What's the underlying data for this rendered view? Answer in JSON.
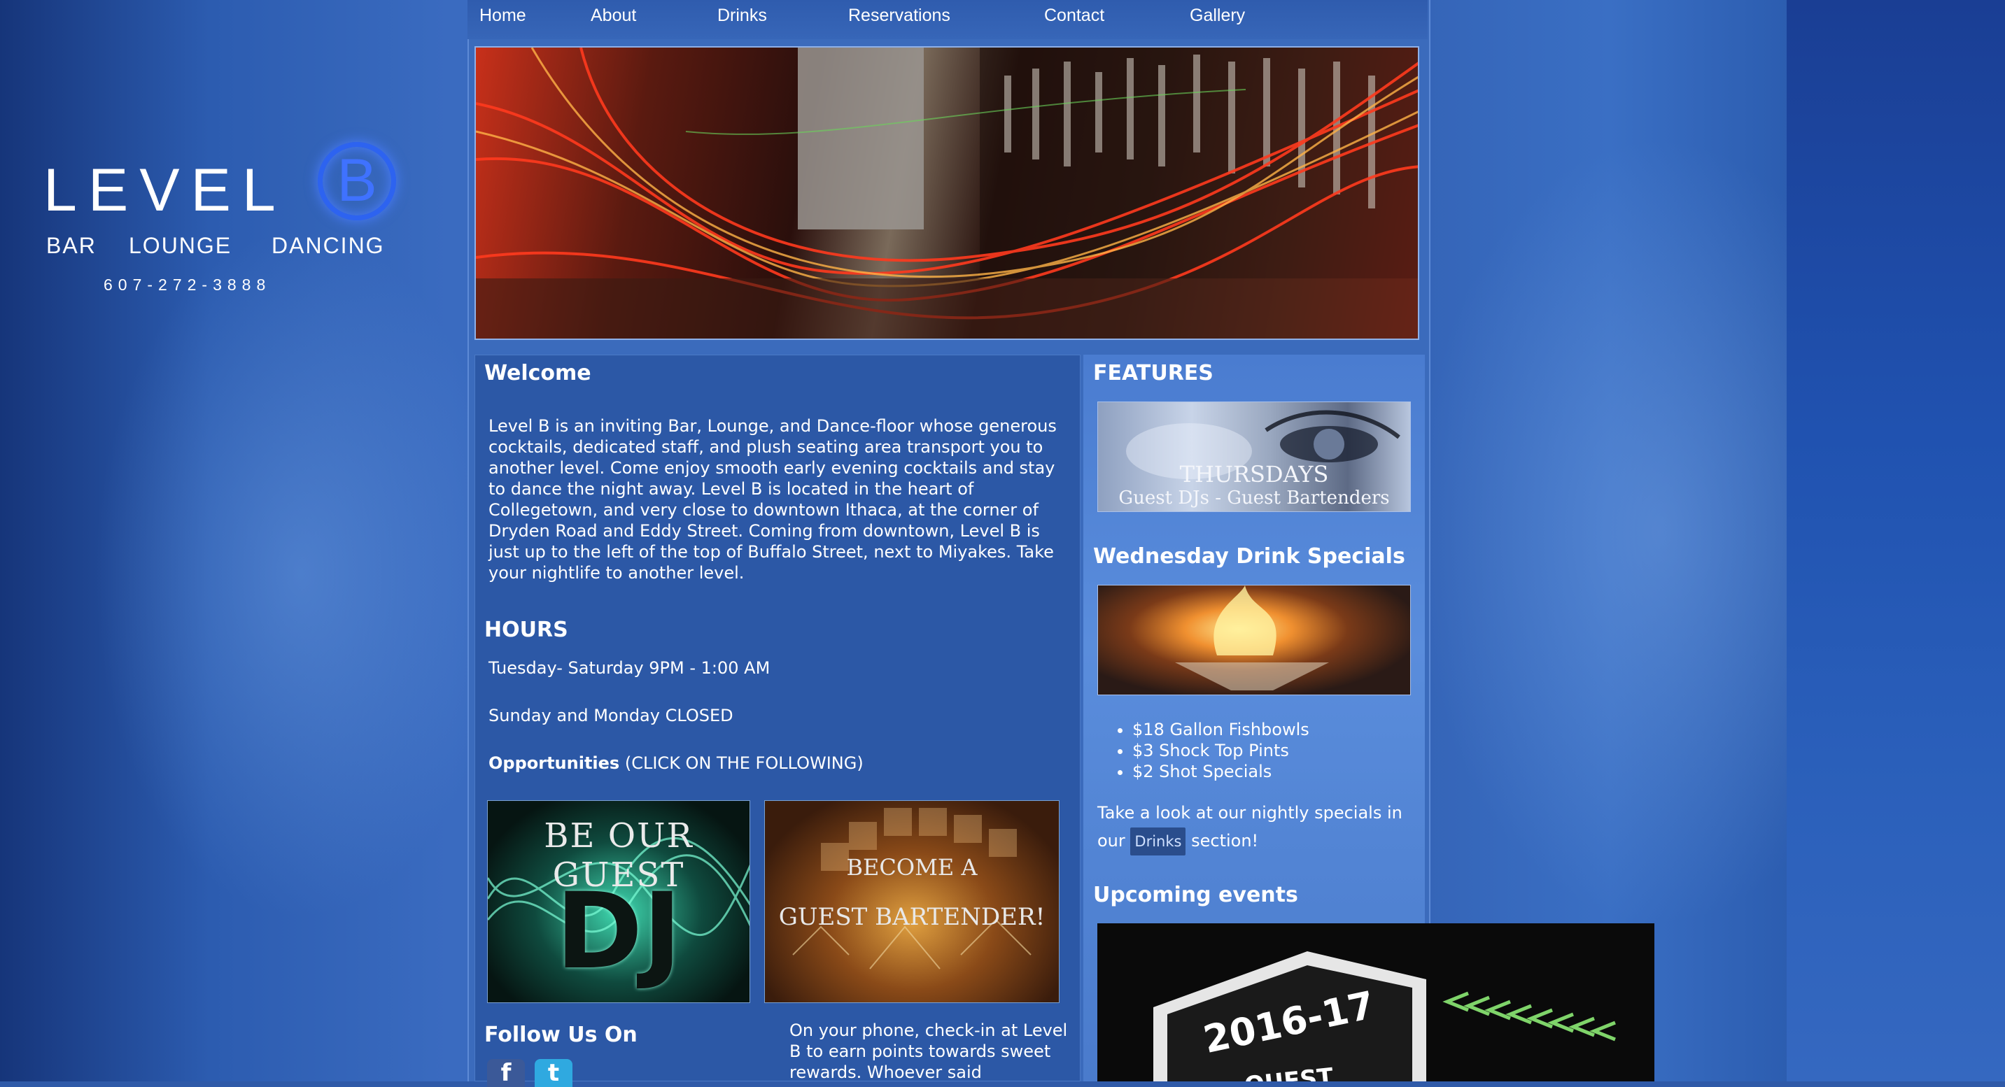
{
  "nav": {
    "items": [
      "Home",
      "About",
      "Drinks",
      "Reservations",
      "Contact",
      "Gallery"
    ]
  },
  "logo": {
    "word": "LEVEL",
    "letter": "B",
    "tag_bar": "BAR",
    "tag_lounge": "LOUNGE",
    "tag_dancing": "DANCING",
    "phone": "607-272-3888"
  },
  "welcome": {
    "heading": "Welcome",
    "body": "Level B is an inviting Bar, Lounge, and Dance-floor whose generous cocktails, dedicated staff, and plush seating area transport you to another level. Come enjoy smooth early evening cocktails and stay to dance the night away. Level B is located in the heart of Collegetown, and very close to downtown Ithaca, at the corner of Dryden Road and Eddy Street. Coming from downtown, Level B is just up to the left of the top of Buffalo Street, next to Miyakes. Take your nightlife to another level."
  },
  "hours": {
    "heading": "HOURS",
    "line1": "Tuesday- Saturday 9PM - 1:00 AM",
    "line2": "Sunday and Monday CLOSED"
  },
  "opportunities": {
    "label": "Opportunities",
    "note": "(CLICK ON THE FOLLOWING)",
    "dj_line1": "BE OUR GUEST",
    "dj_line2": "DJ",
    "bartender_line1": "BECOME A",
    "bartender_line2": "GUEST BARTENDER!"
  },
  "follow": {
    "heading": "Follow Us On",
    "facebook_glyph": "f",
    "twitter_glyph": "t",
    "checkin_text": "On your phone, check-in at Level B to earn points towards sweet rewards. Whoever said"
  },
  "features": {
    "heading": "FEATURES",
    "thursdays_title": "THURSDAYS",
    "thursdays_sub": "Guest DJs - Guest Bartenders"
  },
  "wednesday": {
    "heading": "Wednesday Drink Specials",
    "specials": [
      "$18 Gallon Fishbowls",
      "$3 Shock Top Pints",
      "$2 Shot Specials"
    ],
    "note_before": "Take a look at our nightly specials in our",
    "note_link": "Drinks",
    "note_after": "section!"
  },
  "events": {
    "heading": "Upcoming events",
    "poster_text": "2016-17",
    "poster_bottom": "QUEST"
  },
  "colors": {
    "page_blue": "#3b6bbc",
    "accent_blue": "#2d63f0",
    "panel_blue": "#2c58a6"
  }
}
